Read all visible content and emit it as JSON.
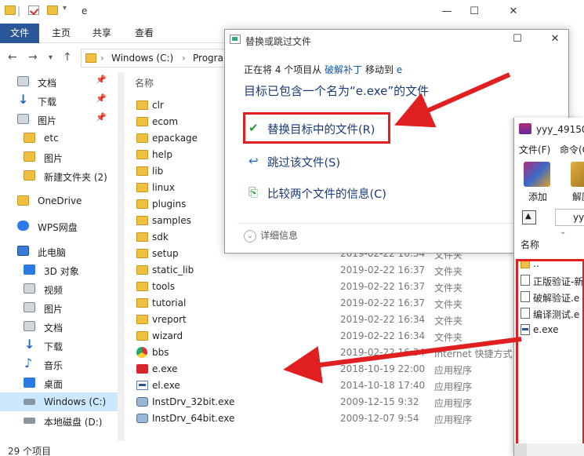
{
  "explorer": {
    "title": "e",
    "ribbon_tabs": [
      "文件",
      "主页",
      "共享",
      "查看"
    ],
    "address_crumbs": [
      "Windows (C:)",
      "Progra"
    ],
    "column_name": "名称",
    "sidebar": [
      {
        "label": "文档",
        "pinned": true,
        "icon": "doc-icon"
      },
      {
        "label": "下载",
        "pinned": true,
        "icon": "download-icon"
      },
      {
        "label": "图片",
        "pinned": true,
        "icon": "picture-icon"
      },
      {
        "label": "etc",
        "pinned": false,
        "icon": "folder-icon"
      },
      {
        "label": "图片",
        "pinned": false,
        "icon": "folder-icon"
      },
      {
        "label": "新建文件夹 (2)",
        "pinned": false,
        "icon": "folder-icon"
      },
      {
        "label": "OneDrive",
        "pinned": false,
        "icon": "onedrive-icon"
      },
      {
        "label": "WPS网盘",
        "pinned": false,
        "icon": "cloud-icon"
      },
      {
        "label": "此电脑",
        "pinned": false,
        "icon": "pc-icon"
      },
      {
        "label": "3D 对象",
        "pinned": false,
        "icon": "3d-icon"
      },
      {
        "label": "视频",
        "pinned": false,
        "icon": "video-icon"
      },
      {
        "label": "图片",
        "pinned": false,
        "icon": "picture-icon"
      },
      {
        "label": "文档",
        "pinned": false,
        "icon": "doc-icon"
      },
      {
        "label": "下载",
        "pinned": false,
        "icon": "download-icon"
      },
      {
        "label": "音乐",
        "pinned": false,
        "icon": "music-icon"
      },
      {
        "label": "桌面",
        "pinned": false,
        "icon": "desktop-icon"
      },
      {
        "label": "Windows (C:)",
        "pinned": false,
        "icon": "drive-icon",
        "selected": true
      },
      {
        "label": "本地磁盘 (D:)",
        "pinned": false,
        "icon": "drive-icon"
      }
    ],
    "files": [
      {
        "name": "clr",
        "date": "",
        "type": "",
        "kind": "folder"
      },
      {
        "name": "ecom",
        "date": "",
        "type": "",
        "kind": "folder"
      },
      {
        "name": "epackage",
        "date": "",
        "type": "",
        "kind": "folder"
      },
      {
        "name": "help",
        "date": "",
        "type": "",
        "kind": "folder"
      },
      {
        "name": "lib",
        "date": "",
        "type": "",
        "kind": "folder"
      },
      {
        "name": "linux",
        "date": "",
        "type": "",
        "kind": "folder"
      },
      {
        "name": "plugins",
        "date": "",
        "type": "",
        "kind": "folder"
      },
      {
        "name": "samples",
        "date": "",
        "type": "",
        "kind": "folder"
      },
      {
        "name": "sdk",
        "date": "",
        "type": "",
        "kind": "folder"
      },
      {
        "name": "setup",
        "date": "2019-02-22 16:34",
        "type": "文件夹",
        "kind": "folder"
      },
      {
        "name": "static_lib",
        "date": "2019-02-22 16:37",
        "type": "文件夹",
        "kind": "folder"
      },
      {
        "name": "tools",
        "date": "2019-02-22 16:37",
        "type": "文件夹",
        "kind": "folder"
      },
      {
        "name": "tutorial",
        "date": "2019-02-22 16:37",
        "type": "文件夹",
        "kind": "folder"
      },
      {
        "name": "vreport",
        "date": "2019-02-22 16:34",
        "type": "文件夹",
        "kind": "folder"
      },
      {
        "name": "wizard",
        "date": "2019-02-22 16:34",
        "type": "文件夹",
        "kind": "folder"
      },
      {
        "name": "bbs",
        "date": "2019-02-22 16:34",
        "type": "Internet 快捷方式",
        "kind": "web"
      },
      {
        "name": "e.exe",
        "date": "2018-10-19 22:00",
        "type": "应用程序",
        "kind": "red"
      },
      {
        "name": "el.exe",
        "date": "2014-10-18 17:40",
        "type": "应用程序",
        "kind": "exe"
      },
      {
        "name": "InstDrv_32bit.exe",
        "date": "2009-12-15 9:32",
        "type": "应用程序",
        "kind": "inst"
      },
      {
        "name": "InstDrv_64bit.exe",
        "date": "2009-12-07 9:54",
        "type": "应用程序",
        "kind": "inst"
      }
    ],
    "status": "29 个项目"
  },
  "dialog": {
    "title": "替换或跳过文件",
    "line1_prefix": "正在将 4 个项目从",
    "line1_src": "破解补丁",
    "line1_mid": "移动到",
    "line1_dst": "e",
    "heading": "目标已包含一个名为“e.exe”的文件",
    "opt_replace": "替换目标中的文件(R)",
    "opt_skip": "跳过该文件(S)",
    "opt_compare": "比较两个文件的信息(C)",
    "details": "详细信息"
  },
  "archive": {
    "title": "yyy_49150.",
    "menu": [
      "文件(F)",
      "命令(C"
    ],
    "tools": [
      "添加",
      "解压"
    ],
    "path": "yyy",
    "column_name": "名称",
    "rows": [
      {
        "name": "..",
        "kind": "fold"
      },
      {
        "name": "正版验证-新",
        "kind": "file"
      },
      {
        "name": "破解验证.e",
        "kind": "file"
      },
      {
        "name": "编译测试.e",
        "kind": "file"
      },
      {
        "name": "e.exe",
        "kind": "exe"
      }
    ]
  },
  "colors": {
    "accent": "#2b579a",
    "highlight": "#e02020",
    "link": "#0a58b5"
  }
}
